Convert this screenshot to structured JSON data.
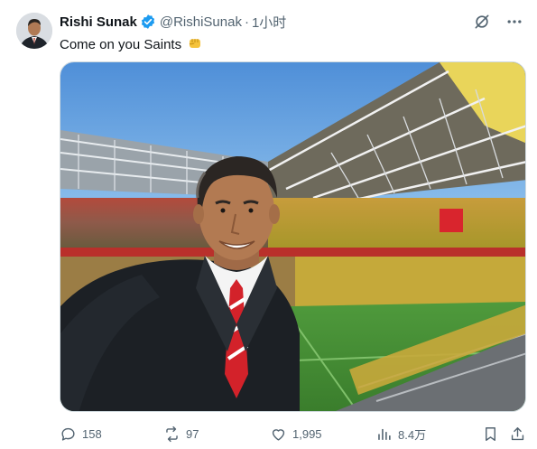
{
  "author": {
    "name": "Rishi Sunak",
    "handle": "@RishiSunak",
    "separator": "·",
    "time": "1小时",
    "verified": true
  },
  "tweet": {
    "text": "Come on you Saints",
    "emoji": "fist-icon"
  },
  "top_actions": {
    "grok_icon": "grok-icon",
    "more_icon": "more-icon"
  },
  "metrics": {
    "replies": "158",
    "retweets": "97",
    "likes": "1,995",
    "views": "8.4万"
  },
  "colors": {
    "verified": "#1d9bf0",
    "secondary_text": "#536471",
    "primary_text": "#0f1419"
  }
}
